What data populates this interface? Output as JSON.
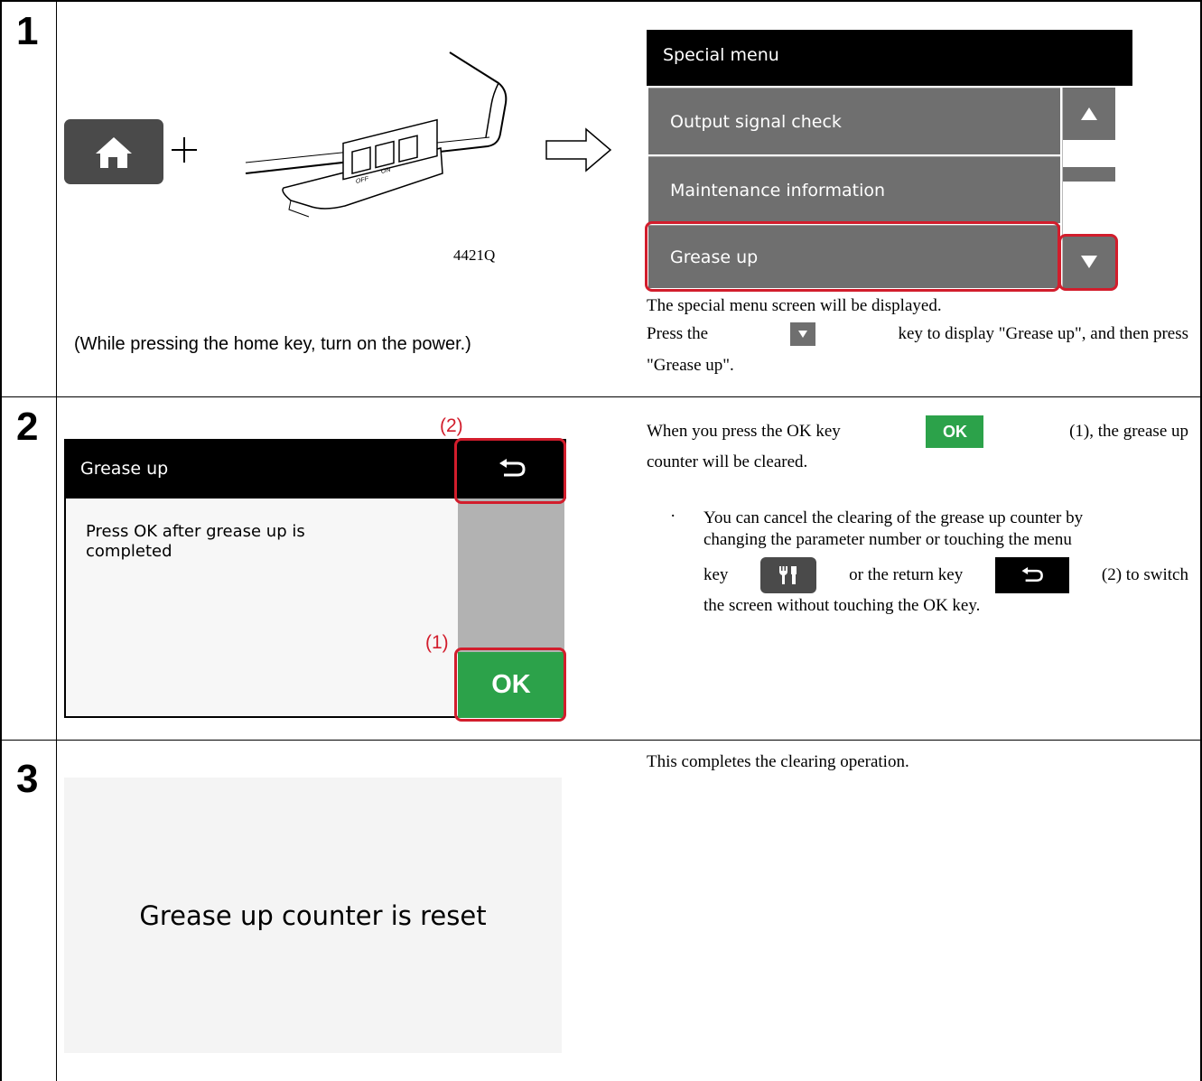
{
  "steps": [
    {
      "number": "1"
    },
    {
      "number": "2"
    },
    {
      "number": "3"
    }
  ],
  "step1": {
    "figure_code": "4421Q",
    "switch_off": "OFF",
    "switch_on": "ON",
    "caption": "(While pressing the home key, turn on the power.)",
    "special_menu": {
      "title": "Special menu",
      "items": [
        "Output signal check",
        "Maintenance information",
        "Grease up"
      ]
    },
    "desc_line1": "The special menu screen will be displayed.",
    "desc_pre": "Press the",
    "desc_post": "key to display \"Grease up\", and then press",
    "desc_end": "\"Grease up\"."
  },
  "step2": {
    "screen_title": "Grease up",
    "screen_message": "Press OK after grease up is completed",
    "ok_label": "OK",
    "callout_return": "(2)",
    "callout_ok": "(1)",
    "para1_pre": "When you press the OK key",
    "para1_post": "(1), the grease up",
    "para1_end": "counter will be cleared.",
    "bullet_mark": "·",
    "bullet_line1": "You can cancel the clearing of the grease up counter by",
    "bullet_line2": "changing the parameter number or touching the menu",
    "bullet_key": "key",
    "bullet_mid": "or the return key",
    "bullet_post": "(2) to switch",
    "bullet_line4": "the screen without touching the OK key."
  },
  "step3": {
    "screen_message": "Grease up counter is reset",
    "desc": "This completes the clearing operation."
  },
  "colors": {
    "ok_green": "#2ca24a",
    "highlight_red": "#d21d2c",
    "menu_gray": "#6f6f6f"
  }
}
